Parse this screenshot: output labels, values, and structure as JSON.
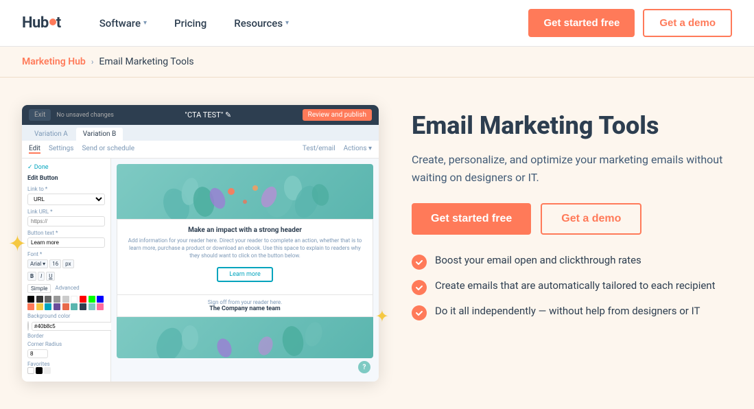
{
  "brand": {
    "name": "HubSpot",
    "spot_color": "#ff7a59"
  },
  "navbar": {
    "links": [
      {
        "label": "Software",
        "has_dropdown": true
      },
      {
        "label": "Pricing",
        "has_dropdown": false
      },
      {
        "label": "Resources",
        "has_dropdown": true
      }
    ],
    "cta_primary": "Get started free",
    "cta_secondary": "Get a demo"
  },
  "breadcrumb": {
    "parent": "Marketing Hub",
    "separator": "›",
    "current": "Email Marketing Tools"
  },
  "hero": {
    "title": "Email Marketing Tools",
    "subtitle": "Create, personalize, and optimize your marketing emails without waiting on designers or IT.",
    "cta_primary": "Get started free",
    "cta_secondary": "Get a demo",
    "features": [
      "Boost your email open and clickthrough rates",
      "Create emails that are automatically tailored to each recipient",
      "Do it all independently — without help from designers or IT"
    ]
  },
  "mockup": {
    "topbar_title": "\"CTA TEST\" ✎",
    "topbar_exit": "Exit",
    "topbar_unsaved": "No unsaved changes",
    "topbar_review": "Review and publish",
    "tabs": [
      "Variation A",
      "Variation B"
    ],
    "active_tab": "Variation B",
    "subnav": [
      "Edit",
      "Settings",
      "Send or schedule"
    ],
    "subnav_active": "Edit",
    "subnav_actions": [
      "Test/email",
      "Actions ▾"
    ],
    "sidebar_title": "Edit Button",
    "sidebar_done": "✓ Done",
    "sidebar_fields": {
      "link_to_label": "Link to *",
      "link_to_value": "URL",
      "link_url_label": "Link URL *",
      "link_url_placeholder": "https://",
      "button_text_label": "Button text *",
      "button_text_value": "Learn more",
      "font_label": "Font *"
    },
    "email_preview": {
      "header_text": "Make an impact with a strong header",
      "body_text": "Add information for your reader here. Direct your reader to complete an action, whether that is to learn more, purchase a product or download an ebook. Use this space to explain to readers why they should want to click on the button below.",
      "button_text": "Learn more",
      "signoff": "Sign off from your reader here.",
      "company": "The Company name team"
    }
  },
  "colors": {
    "accent": "#ff7a59",
    "bg_main": "#fdf6ee",
    "text_dark": "#2d3e50",
    "text_mid": "#425b76"
  }
}
